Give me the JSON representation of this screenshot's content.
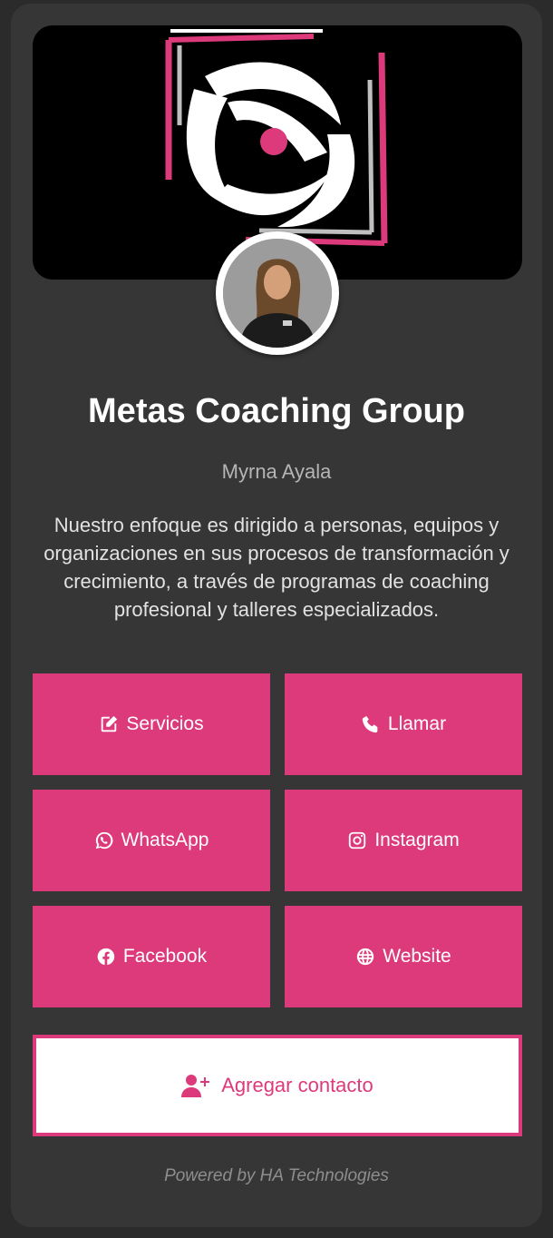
{
  "profile": {
    "title": "Metas Coaching Group",
    "name": "Myrna Ayala",
    "description": "Nuestro enfoque es dirigido a personas, equipos y organizaciones en sus procesos de transformación y crecimiento, a través de programas de coaching profesional y talleres especializados."
  },
  "buttons": {
    "servicios": {
      "label": "Servicios",
      "icon": "edit-icon"
    },
    "llamar": {
      "label": "Llamar",
      "icon": "phone-icon"
    },
    "whatsapp": {
      "label": "WhatsApp",
      "icon": "whatsapp-icon"
    },
    "instagram": {
      "label": "Instagram",
      "icon": "instagram-icon"
    },
    "facebook": {
      "label": "Facebook",
      "icon": "facebook-icon"
    },
    "website": {
      "label": "Website",
      "icon": "globe-icon"
    }
  },
  "add_contact": {
    "label": "Agregar contacto",
    "icon": "user-plus-icon"
  },
  "footer": {
    "text": "Powered by HA Technologies"
  },
  "colors": {
    "accent": "#dc3a7b",
    "background": "#2b2b2b",
    "card": "#363636"
  }
}
